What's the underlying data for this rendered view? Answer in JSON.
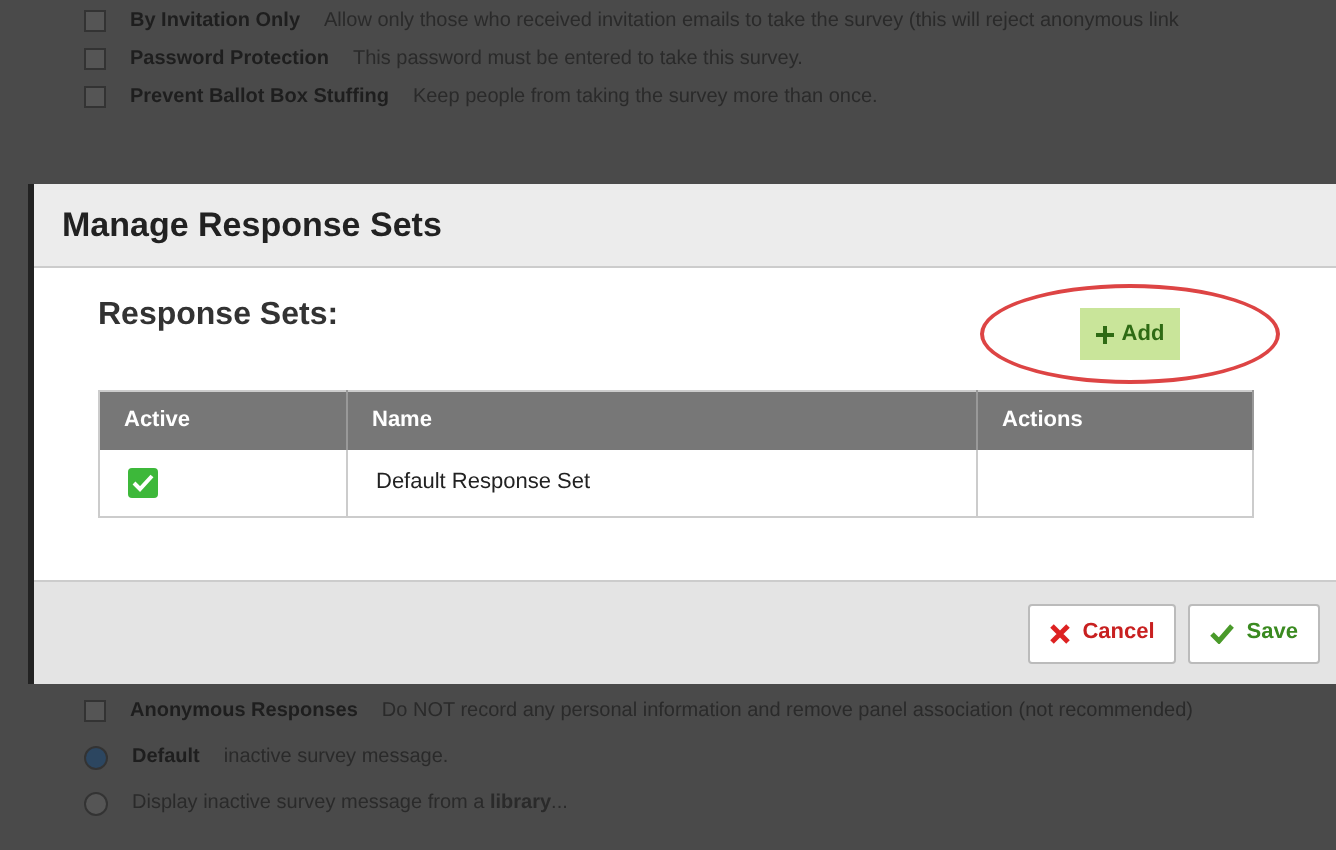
{
  "background_options_top": [
    {
      "kind": "checkbox",
      "checked": false,
      "label": "By Invitation Only",
      "description": "Allow only those who received invitation emails to take the survey (this will reject anonymous link"
    },
    {
      "kind": "checkbox",
      "checked": false,
      "label": "Password Protection",
      "description": "This password must be entered to take this survey."
    },
    {
      "kind": "checkbox",
      "checked": false,
      "label": "Prevent Ballot Box Stuffing",
      "description": "Keep people from taking the survey more than once."
    }
  ],
  "dialog": {
    "title": "Manage Response Sets",
    "heading": "Response Sets:",
    "add_button": "Add",
    "table": {
      "columns": [
        "Active",
        "Name",
        "Actions"
      ],
      "rows": [
        {
          "active": true,
          "name": "Default Response Set"
        }
      ]
    },
    "buttons": [
      {
        "kind": "cancel",
        "label": "Cancel"
      },
      {
        "kind": "save",
        "label": "Save"
      }
    ]
  },
  "background_options_bottom": [
    {
      "kind": "checkbox",
      "checked": false,
      "label": "Anonymous Responses",
      "description": "Do NOT record any personal information and remove panel association (not recommended)"
    },
    {
      "kind": "radio",
      "label": "Default",
      "description": "inactive survey message.",
      "selected": true
    },
    {
      "kind": "radio",
      "description": "Display inactive survey message from a **library**...",
      "selected": false
    }
  ]
}
